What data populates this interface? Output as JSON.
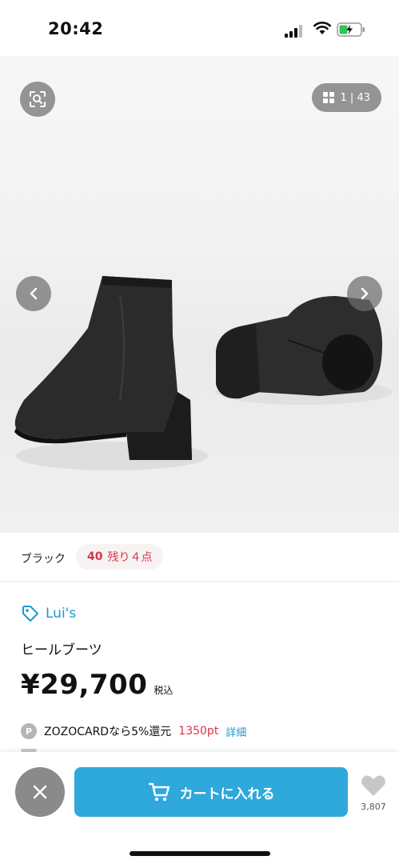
{
  "status_bar": {
    "time": "20:42"
  },
  "gallery": {
    "counter": "1 | 43"
  },
  "color_row": {
    "color_name": "ブラック",
    "size": "40",
    "stock": "残り４点"
  },
  "product": {
    "brand": "Lui's",
    "title": "ヒールブーツ",
    "price": "¥29,700",
    "tax_label": "税込"
  },
  "points": {
    "badge": "P",
    "text": "ZOZOCARDなら5%還元",
    "points_value": "1350pt",
    "detail_link": "詳細"
  },
  "bottom_bar": {
    "cart_label": "カートに入れる",
    "favorite_count": "3,807"
  },
  "colors": {
    "accent_blue": "#2fa8dc",
    "link_blue": "#1a9bd1",
    "alert_red": "#d9334b"
  }
}
